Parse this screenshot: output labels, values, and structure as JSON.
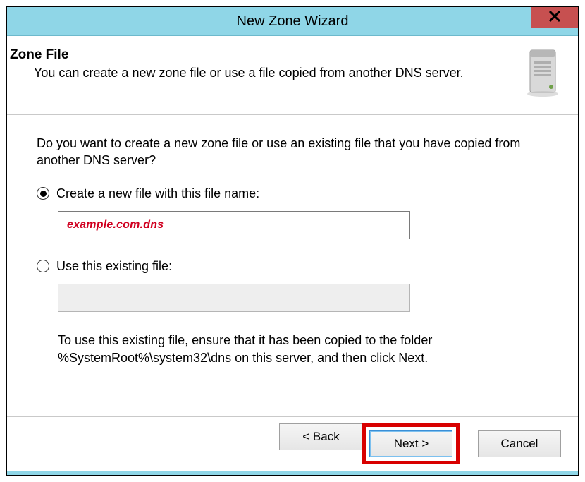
{
  "window": {
    "title": "New Zone Wizard"
  },
  "header": {
    "heading": "Zone File",
    "subheading": "You can create a new zone file or use a file copied from another DNS server."
  },
  "body": {
    "prompt": "Do you want to create a new zone file or use an existing file that you have copied from another DNS server?",
    "option_create_label": "Create a new file with this file name:",
    "create_filename": "example.com.dns",
    "option_existing_label": "Use this existing file:",
    "existing_filename": "",
    "note": "To use this existing file, ensure that it has been copied to the folder %SystemRoot%\\system32\\dns on this server, and then click Next."
  },
  "footer": {
    "back_label": "< Back",
    "next_label": "Next >",
    "cancel_label": "Cancel"
  },
  "icons": {
    "close": "close-icon",
    "server": "server-tower-icon"
  }
}
